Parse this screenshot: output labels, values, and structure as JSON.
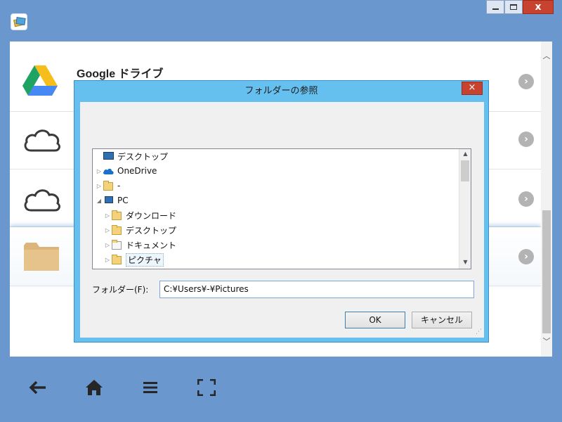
{
  "window": {
    "minimize_label": "",
    "maximize_label": "",
    "close_label": "x"
  },
  "list": {
    "items": [
      {
        "label": "Google ドライブ",
        "icon": "google-drive-icon"
      },
      {
        "label": "",
        "icon": "cloud-icon"
      },
      {
        "label": "",
        "icon": "cloud-icon"
      },
      {
        "label": "",
        "icon": "folder-icon"
      }
    ]
  },
  "nav": {
    "icons": [
      "back-arrow-icon",
      "home-icon",
      "menu-icon",
      "fullscreen-icon"
    ]
  },
  "dialog": {
    "title": "フォルダーの参照",
    "close_label": "×",
    "tree": [
      {
        "label": "デスクトップ",
        "icon": "desktop-icon"
      },
      {
        "label": "OneDrive",
        "icon": "onedrive-icon"
      },
      {
        "label": "-",
        "icon": "user-folder-icon"
      },
      {
        "label": "PC",
        "icon": "pc-icon"
      },
      {
        "label": "ダウンロード",
        "icon": "download-folder-icon"
      },
      {
        "label": "デスクトップ",
        "icon": "desktop-folder-icon"
      },
      {
        "label": "ドキュメント",
        "icon": "documents-folder-icon"
      },
      {
        "label": "ピクチャ",
        "icon": "pictures-folder-icon"
      }
    ],
    "folder_label": "フォルダー(F):",
    "folder_value": "C:¥Users¥-¥Pictures",
    "ok_label": "OK",
    "cancel_label": "キャンセル"
  },
  "colors": {
    "background": "#6b97cf",
    "dialog_frame": "#65c0f0",
    "close_button": "#c8432f"
  }
}
